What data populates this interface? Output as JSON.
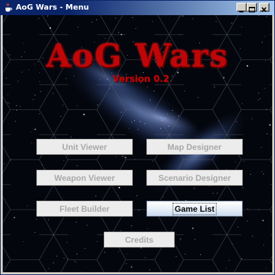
{
  "window": {
    "title": "AoG Wars - Menu"
  },
  "app": {
    "logo": "AoG Wars",
    "version": "Version 0.2"
  },
  "buttons": {
    "unit_viewer": "Unit Viewer",
    "map_designer": "Map Designer",
    "weapon_viewer": "Weapon Viewer",
    "scenario_designer": "Scenario Designer",
    "fleet_builder": "Fleet Builder",
    "game_list": "Game List",
    "credits": "Credits"
  },
  "colors": {
    "accent": "#c00608",
    "titlebar": "#0a246a"
  }
}
